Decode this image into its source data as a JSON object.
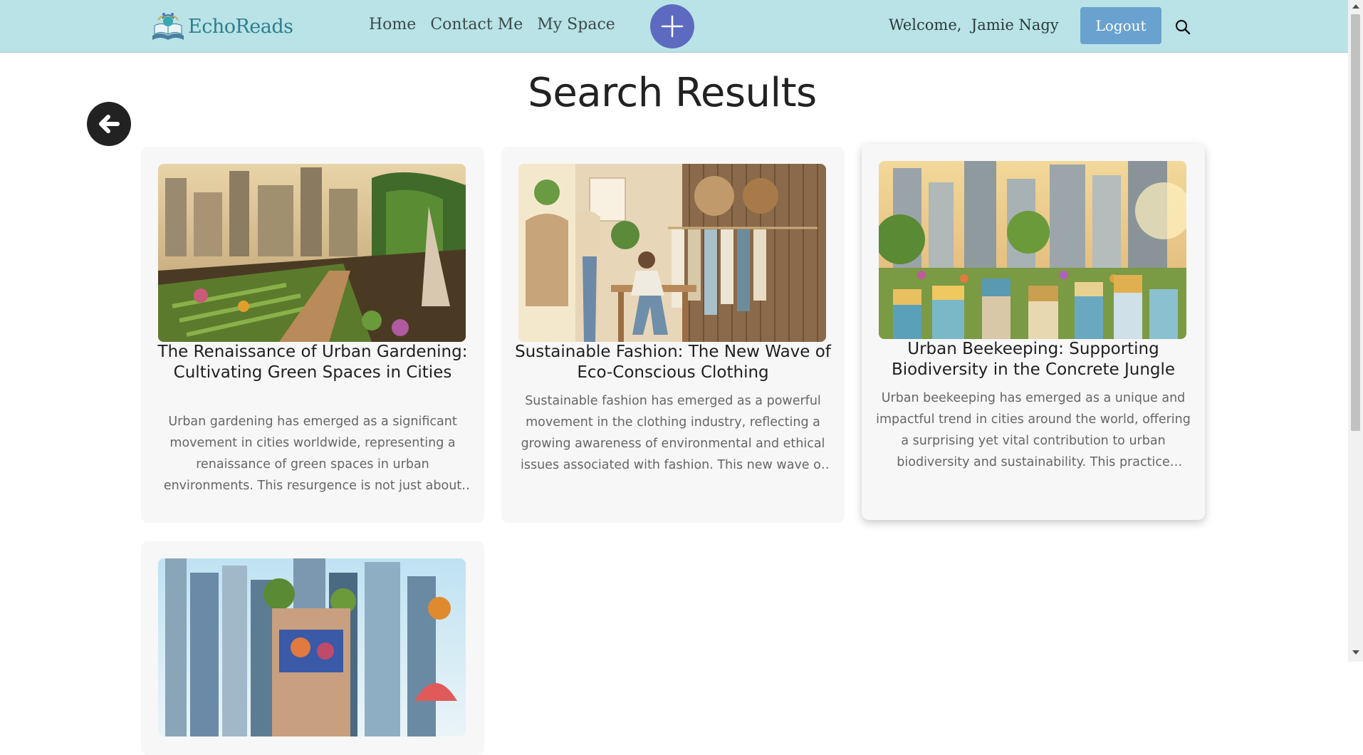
{
  "header": {
    "logo_text": "EchoReads",
    "nav": [
      "Home",
      "Contact Me",
      "My Space"
    ],
    "welcome": "Welcome,  Jamie Nagy",
    "logout_label": "Logout",
    "add_icon": "plus-icon",
    "search_icon": "search-icon",
    "colors": {
      "bar": "#b9e3e6",
      "add_button": "#5c6bc0",
      "logout_button": "#6aa2cf"
    }
  },
  "page": {
    "title": "Search Results",
    "back_icon": "arrow-left-circle-icon"
  },
  "results": [
    {
      "title": "The Renaissance of Urban Gardening: Cultivating Green Spaces in Cities",
      "excerpt": "Urban gardening has emerged as a significant movement in cities worldwide, representing a renaissance of green spaces in urban environments. This resurgence is not just about beautifying cities and making them more livable."
    },
    {
      "title": "Sustainable Fashion: The New Wave of Eco-Conscious Clothing",
      "excerpt": "Sustainable fashion has emerged as a powerful movement in the clothing industry, reflecting a growing awareness of environmental and ethical issues associated with fashion. This new wave of eco-conscious designers is reshaping the industry."
    },
    {
      "title": "Urban Beekeeping: Supporting Biodiversity in the Concrete Jungle",
      "excerpt": "Urban beekeeping has emerged as a unique and impactful trend in cities around the world, offering a surprising yet vital contribution to urban biodiversity and sustainability. This practice involves keeping a colony of bees on rooftops."
    }
  ]
}
